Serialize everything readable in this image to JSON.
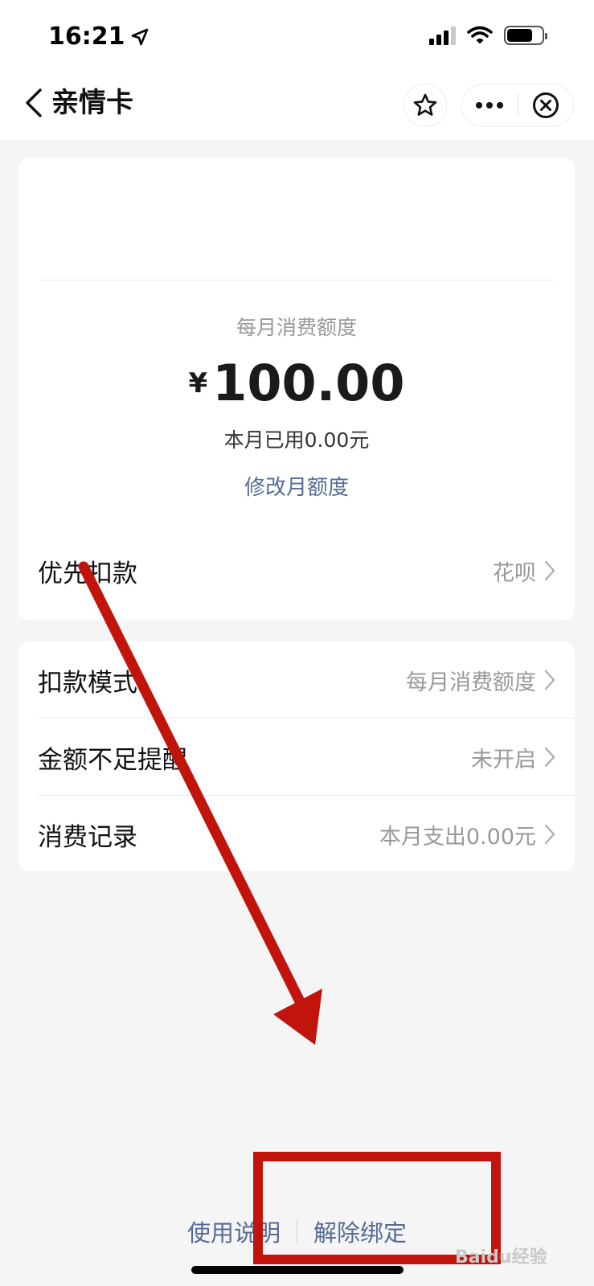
{
  "status_bar": {
    "time": "16:21"
  },
  "header": {
    "title": "亲情卡"
  },
  "quota": {
    "label": "每月消费额度",
    "currency": "¥",
    "amount": "100.00",
    "used_text": "本月已用0.00元",
    "modify_link": "修改月额度"
  },
  "priority_row": {
    "label": "优先扣款",
    "value": "花呗"
  },
  "settings_rows": [
    {
      "label": "扣款模式",
      "value": "每月消费额度"
    },
    {
      "label": "金额不足提醒",
      "value": "未开启"
    },
    {
      "label": "消费记录",
      "value": "本月支出0.00元"
    }
  ],
  "bottom_links": {
    "usage": "使用说明",
    "unbind": "解除绑定"
  },
  "watermark": "Baidu经验",
  "colors": {
    "link": "#576b95",
    "annotation": "#c0140c",
    "background": "#f5f5f5"
  }
}
